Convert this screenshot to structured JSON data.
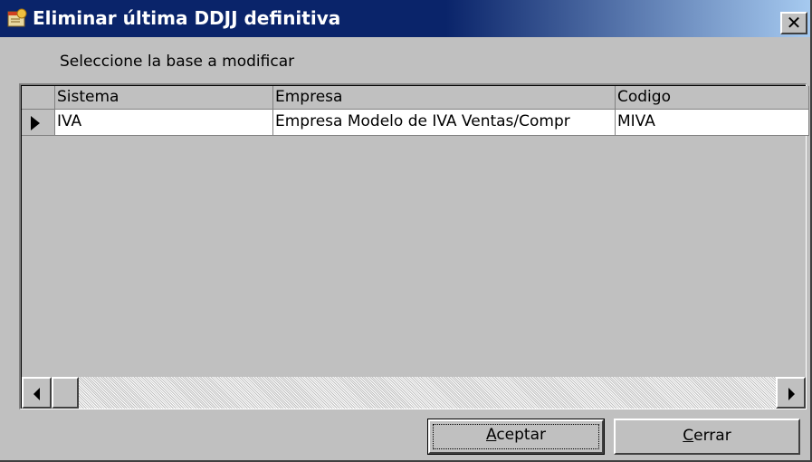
{
  "window": {
    "title": "Eliminar última DDJJ definitiva",
    "close_glyph": "✕",
    "icon": "app-notebook-icon"
  },
  "prompt": "Seleccione la base a modificar",
  "grid": {
    "columns": [
      "Sistema",
      "Empresa",
      "Codigo"
    ],
    "rows": [
      {
        "sistema": "IVA",
        "empresa": "Empresa Modelo de IVA Ventas/Compr",
        "codigo": "MIVA",
        "current": true
      }
    ]
  },
  "buttons": {
    "accept": {
      "mnemonic": "A",
      "rest": "ceptar"
    },
    "close": {
      "mnemonic": "C",
      "rest": "errar"
    }
  },
  "colors": {
    "title_start": "#0a246a",
    "title_end": "#a6caf0",
    "face": "#c0c0c0"
  }
}
